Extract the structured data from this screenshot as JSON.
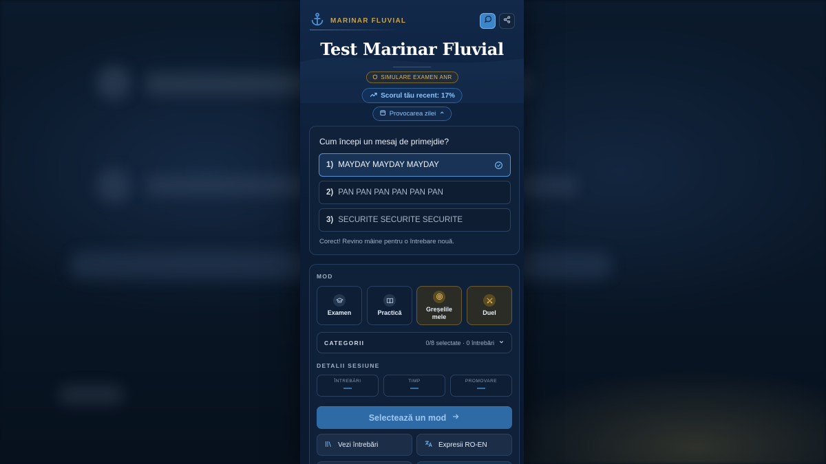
{
  "header": {
    "brand": "MARINAR FLUVIAL",
    "title": "Test Marinar Fluvial"
  },
  "badges": {
    "exam": "SIMULARE EXAMEN ANR",
    "score": "Scorul tău recent: 17%",
    "daily": "Provocarea zilei"
  },
  "daily_question": {
    "question": "Cum începi un mesaj de primejdie?",
    "options": [
      {
        "num": "1)",
        "text": "MAYDAY MAYDAY MAYDAY",
        "state": "correct"
      },
      {
        "num": "2)",
        "text": "PAN PAN PAN PAN PAN PAN",
        "state": "default"
      },
      {
        "num": "3)",
        "text": "SECURITE SECURITE SECURITE",
        "state": "default"
      }
    ],
    "feedback": "Corect! Revino mâine pentru o întrebare nouă."
  },
  "mode": {
    "label": "MOD",
    "options": [
      {
        "label": "Examen",
        "icon": "graduation-cap-icon"
      },
      {
        "label": "Practică",
        "icon": "book-icon"
      },
      {
        "label": "Greșelile mele",
        "icon": "target-icon"
      },
      {
        "label": "Duel",
        "icon": "crossed-swords-icon"
      }
    ]
  },
  "categories": {
    "label": "CATEGORII",
    "value": "0/8 selectate · 0 întrebări"
  },
  "session": {
    "label": "DETALII SESIUNE",
    "stats": [
      {
        "label": "ÎNTREBĂRI",
        "value": "—"
      },
      {
        "label": "TIMP",
        "value": "—"
      },
      {
        "label": "PROMOVARE",
        "value": "—"
      }
    ]
  },
  "actions": {
    "primary": "Selectează un mod",
    "view_questions": "Vezi întrebări",
    "phrases": "Expresii RO-EN"
  },
  "colors": {
    "accent": "#3a86c8",
    "gold": "#c9a24a",
    "background": "#0c1c34"
  }
}
